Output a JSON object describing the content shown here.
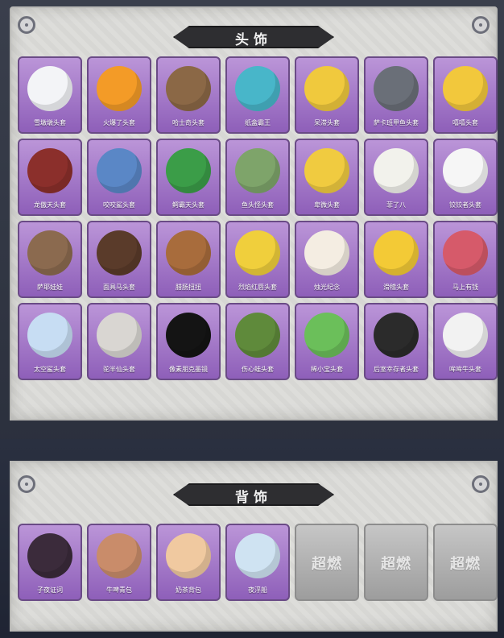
{
  "head_section": {
    "title": "头饰",
    "items": [
      {
        "label": "雪墩墩头套",
        "color": "#f3f4f7"
      },
      {
        "label": "火爆了头套",
        "color": "#f39b27"
      },
      {
        "label": "哈士奇头套",
        "color": "#8b6846"
      },
      {
        "label": "纸盒霸王",
        "color": "#48b6c9"
      },
      {
        "label": "呆滞头套",
        "color": "#f0c93d"
      },
      {
        "label": "萨卡班甲鱼头套",
        "color": "#6a6f78"
      },
      {
        "label": "嘻嘻头套",
        "color": "#f2c83c"
      },
      {
        "label": "龙傲天头套",
        "color": "#8b2f2b"
      },
      {
        "label": "咬咬鲨头套",
        "color": "#5a87c6"
      },
      {
        "label": "鳄霸天头套",
        "color": "#3b9d48"
      },
      {
        "label": "鱼头怪头套",
        "color": "#7ea46a"
      },
      {
        "label": "卑微头套",
        "color": "#f0cb40"
      },
      {
        "label": "菲了八",
        "color": "#f2f2ec"
      },
      {
        "label": "铰铰者头套",
        "color": "#f6f6f6"
      },
      {
        "label": "萨耶娃娃",
        "color": "#8b6a4f"
      },
      {
        "label": "面具马头套",
        "color": "#5a3b2a"
      },
      {
        "label": "腊肠扭扭",
        "color": "#a86c3c"
      },
      {
        "label": "烈焰红唇头套",
        "color": "#f0cf3c"
      },
      {
        "label": "烛光纪念",
        "color": "#f4ede2"
      },
      {
        "label": "滑稽头套",
        "color": "#f3ca36"
      },
      {
        "label": "马上有钱",
        "color": "#d65a6a"
      },
      {
        "label": "太空鲨头套",
        "color": "#c7ddf3"
      },
      {
        "label": "驼半仙头套",
        "color": "#d9d6d2"
      },
      {
        "label": "像素朋克墨镜",
        "color": "#141414"
      },
      {
        "label": "伤心蛙头套",
        "color": "#5f8a3b"
      },
      {
        "label": "稀小宝头套",
        "color": "#6bbf5a"
      },
      {
        "label": "后室幸存者头套",
        "color": "#2b2b2b"
      },
      {
        "label": "哞哞牛头套",
        "color": "#f2f2f2"
      }
    ]
  },
  "back_section": {
    "title": "背饰",
    "items": [
      {
        "label": "子夜证词",
        "color": "#3b2b3b",
        "empty": false
      },
      {
        "label": "牛啤青包",
        "color": "#c98c6a",
        "empty": false
      },
      {
        "label": "奶茶背包",
        "color": "#f0c9a0",
        "empty": false
      },
      {
        "label": "夜浮船",
        "color": "#cfe3f2",
        "empty": false
      },
      {
        "label": "",
        "placeholder": "超燃",
        "empty": true
      },
      {
        "label": "",
        "placeholder": "超燃",
        "empty": true
      },
      {
        "label": "",
        "placeholder": "超燃",
        "empty": true
      }
    ]
  }
}
